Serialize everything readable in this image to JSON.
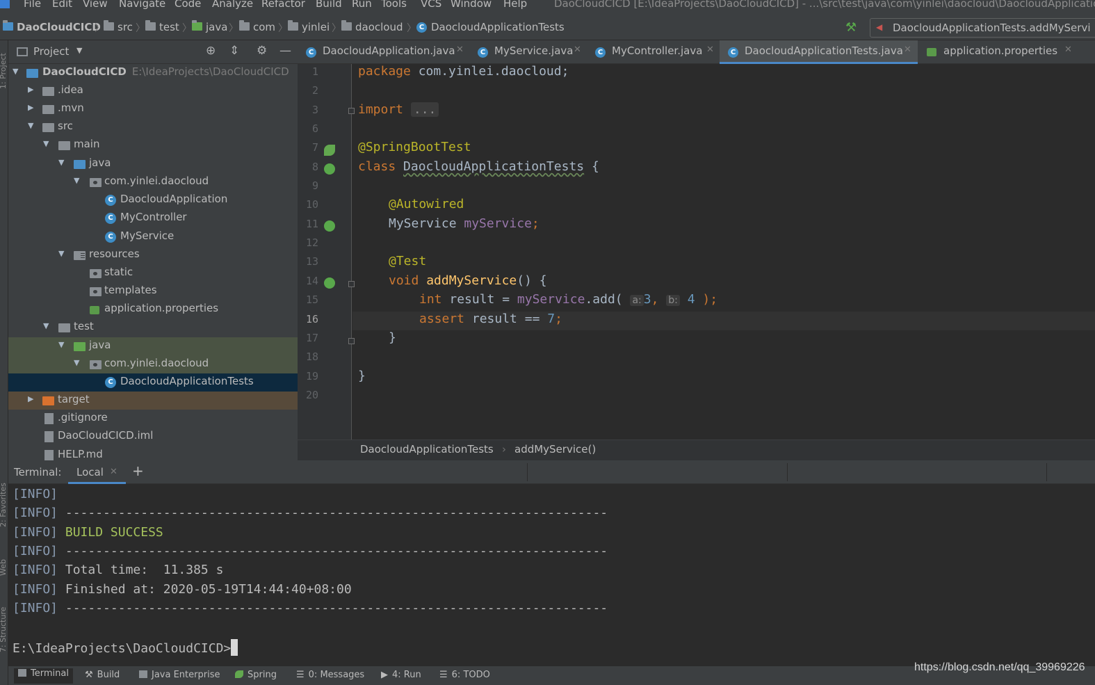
{
  "menu": {
    "items": [
      "File",
      "Edit",
      "View",
      "Navigate",
      "Code",
      "Analyze",
      "Refactor",
      "Build",
      "Run",
      "Tools",
      "VCS",
      "Window",
      "Help"
    ],
    "window_title": "DaoCloudCICD [E:\\IdeaProjects\\DaoCloudCICD] - ...\\src\\test\\java\\com\\yinlei\\daocloud\\DaocloudApplicatio"
  },
  "navbar": {
    "crumbs": [
      "DaoCloudCICD",
      "src",
      "test",
      "java",
      "com",
      "yinlei",
      "daocloud",
      "DaocloudApplicationTests"
    ],
    "run_config": "DaocloudApplicationTests.addMyServi"
  },
  "stripe": {
    "project": "1: Project",
    "favorites": "2: Favorites",
    "web": "Web",
    "structure": "7: Structure"
  },
  "project": {
    "title": "Project",
    "tree": [
      {
        "label": "DaoCloudCICD",
        "path": "E:\\IdeaProjects\\DaoCloudCICD"
      },
      {
        "label": ".idea"
      },
      {
        "label": ".mvn"
      },
      {
        "label": "src"
      },
      {
        "label": "main"
      },
      {
        "label": "java"
      },
      {
        "label": "com.yinlei.daocloud"
      },
      {
        "label": "DaocloudApplication"
      },
      {
        "label": "MyController"
      },
      {
        "label": "MyService"
      },
      {
        "label": "resources"
      },
      {
        "label": "static"
      },
      {
        "label": "templates"
      },
      {
        "label": "application.properties"
      },
      {
        "label": "test"
      },
      {
        "label": "java"
      },
      {
        "label": "com.yinlei.daocloud"
      },
      {
        "label": "DaocloudApplicationTests"
      },
      {
        "label": "target"
      },
      {
        "label": ".gitignore"
      },
      {
        "label": "DaoCloudCICD.iml"
      },
      {
        "label": "HELP.md"
      }
    ]
  },
  "editor": {
    "tabs": [
      {
        "label": "DaocloudApplication.java"
      },
      {
        "label": "MyService.java"
      },
      {
        "label": "MyController.java"
      },
      {
        "label": "DaocloudApplicationTests.java"
      },
      {
        "label": "application.properties"
      }
    ],
    "line_numbers": [
      "1",
      "2",
      "3",
      "6",
      "7",
      "8",
      "9",
      "10",
      "11",
      "12",
      "13",
      "14",
      "15",
      "16",
      "17",
      "18",
      "19",
      "20"
    ],
    "code": {
      "l1_kw": "package",
      "l1_rest": " com.yinlei.daocloud;",
      "l3_kw": "import",
      "l3_fold": "...",
      "l7_ann": "@SpringBootTest",
      "l8_kw": "class",
      "l8_cls": "DaocloudApplicationTests",
      "l8_rest": " {",
      "l10_ann": "@Autowired",
      "l11_type": "MyService ",
      "l11_fld": "myService",
      "l11_semi": ";",
      "l13_ann": "@Test",
      "l14_kw": "void",
      "l14_fn": "addMyService",
      "l14_rest": "() {",
      "l15_kw": "int",
      "l15_a": " result = ",
      "l15_fld": "myService",
      "l15_b": ".add( ",
      "l15_hint_a": "a:",
      "l15_num_a": "3",
      "l15_comma": ", ",
      "l15_hint_b": "b:",
      "l15_num_b": "4",
      "l15_end": " );",
      "l16_kw": "assert",
      "l16_a": " result == ",
      "l16_num": "7",
      "l16_semi": ";",
      "l17": "}",
      "l19": "}"
    },
    "breadcrumb": [
      "DaocloudApplicationTests",
      "addMyService()"
    ]
  },
  "terminal": {
    "title": "Terminal:",
    "tab": "Local",
    "lines": [
      {
        "tag": "[INFO]",
        "text": ""
      },
      {
        "tag": "[INFO]",
        "text": " ------------------------------------------------------------------------"
      },
      {
        "tag": "[INFO]",
        "text": " BUILD SUCCESS"
      },
      {
        "tag": "[INFO]",
        "text": " ------------------------------------------------------------------------"
      },
      {
        "tag": "[INFO]",
        "text": " Total time:  11.385 s"
      },
      {
        "tag": "[INFO]",
        "text": " Finished at: 2020-05-19T14:44:40+08:00"
      },
      {
        "tag": "[INFO]",
        "text": " ------------------------------------------------------------------------"
      }
    ],
    "prompt": "E:\\IdeaProjects\\DaoCloudCICD>"
  },
  "bottom_bar": {
    "items": [
      "Terminal",
      "Build",
      "Java Enterprise",
      "Spring",
      "0: Messages",
      "4: Run",
      "6: TODO"
    ]
  },
  "watermark": "https://blog.csdn.net/qq_39969226",
  "colors": {
    "keyword": "#cc7832",
    "annotation": "#bbb529",
    "field": "#9876aa",
    "number": "#6897bb",
    "method": "#ffc66d",
    "success": "#a5c25c",
    "accent": "#4a88c7"
  }
}
